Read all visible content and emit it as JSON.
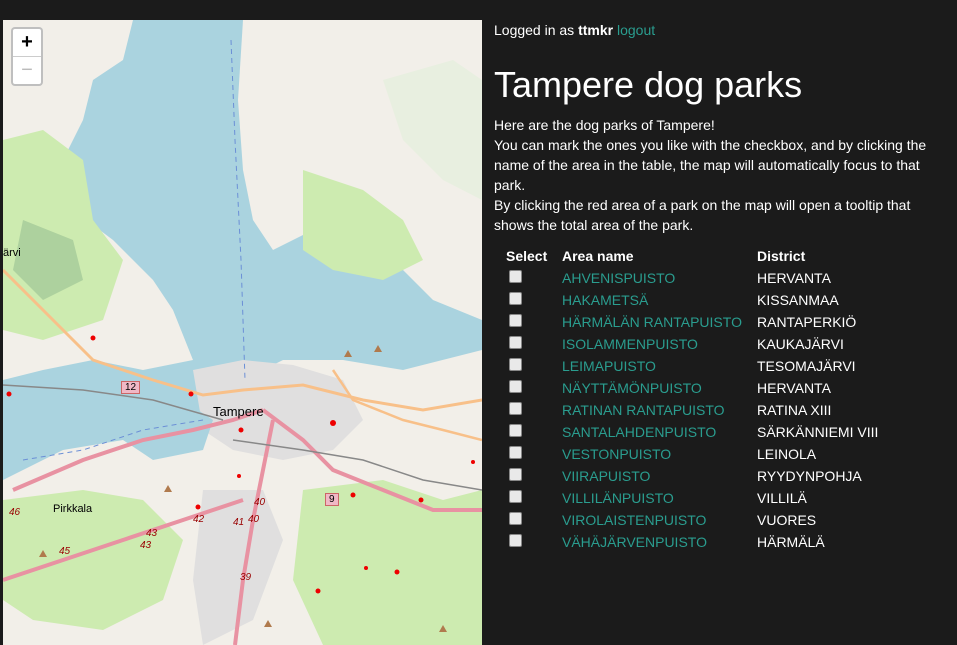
{
  "map": {
    "zoom_in": "+",
    "zoom_out": "−",
    "labels": {
      "city": "Tampere",
      "pirkkala": "Pirkkala",
      "jarvi": "ärvi",
      "road12": "12",
      "road9": "9",
      "r40a": "40",
      "r40b": "40",
      "r41": "41",
      "r42": "42",
      "r43a": "43",
      "r43b": "43",
      "r45": "45",
      "r46": "46",
      "r39": "39"
    }
  },
  "header": {
    "logged_in_prefix": "Logged in as",
    "username": "ttmkr",
    "logout": "logout"
  },
  "title": "Tampere dog parks",
  "intro": [
    "Here are the dog parks of Tampere!",
    "You can mark the ones you like with the checkbox, and by clicking the name of the area in the table, the map will automatically focus to that park.",
    "By clicking the red area of a park on the map will open a tooltip that shows the total area of the park."
  ],
  "table": {
    "headers": [
      "Select",
      "Area name",
      "District"
    ],
    "rows": [
      {
        "area": "AHVENISPUISTO",
        "district": "HERVANTA"
      },
      {
        "area": "HAKAMETSÄ",
        "district": "KISSANMAA"
      },
      {
        "area": "HÄRMÄLÄN RANTAPUISTO",
        "district": "RANTAPERKIÖ"
      },
      {
        "area": "ISOLAMMENPUISTO",
        "district": "KAUKAJÄRVI"
      },
      {
        "area": "LEIMAPUISTO",
        "district": "TESOMAJÄRVI"
      },
      {
        "area": "NÄYTTÄMÖNPUISTO",
        "district": "HERVANTA"
      },
      {
        "area": "RATINAN RANTAPUISTO",
        "district": "RATINA XIII"
      },
      {
        "area": "SANTALAHDENPUISTO",
        "district": "SÄRKÄNNIEMI VIII"
      },
      {
        "area": "VESTONPUISTO",
        "district": "LEINOLA"
      },
      {
        "area": "VIIRAPUISTO",
        "district": "RYYDYNPOHJA"
      },
      {
        "area": "VILLILÄNPUISTO",
        "district": "VILLILÄ"
      },
      {
        "area": "VIROLAISTENPUISTO",
        "district": "VUORES"
      },
      {
        "area": "VÄHÄJÄRVENPUISTO",
        "district": "HÄRMÄLÄ"
      }
    ]
  }
}
